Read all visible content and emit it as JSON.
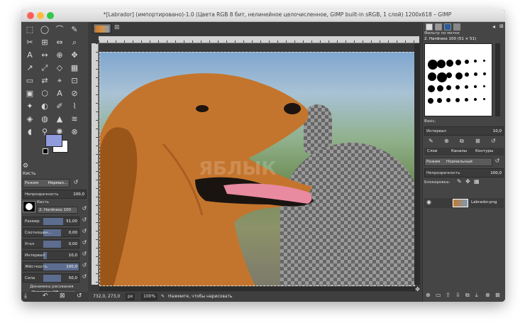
{
  "window": {
    "title": "*[Labrador] (импортировано)-1.0 (Цвета RGB 8 бит, нелинейное целочисленное, GIMP built-in sRGB, 1 слой) 1200x618 – GIMP"
  },
  "colors": {
    "close": "#fc605b",
    "minimize": "#fdbc40",
    "zoom": "#34c84a",
    "fg": "#8f9bdc",
    "bg": "#ffffff",
    "accent": "#5d6d8f"
  },
  "toolbox": {
    "tool_icons": [
      "⬚",
      "◯",
      "⌒",
      "✎",
      "✂",
      "⊞",
      "⇔",
      "⌕",
      "A",
      "↔",
      "⊕",
      "✥",
      "↗",
      "⤢",
      "◇",
      "▦",
      "▭",
      "⇄",
      "⌖",
      "⊡",
      "▣",
      "⬡",
      "A",
      "⊘",
      "✦",
      "◐",
      "✐",
      "⌇",
      "◈",
      "◍",
      "▲",
      "≋",
      "◖",
      "⚲",
      "✺",
      "⊗"
    ],
    "section_title": "Кисть",
    "mode_label": "Режим",
    "mode_value": "Нормал...",
    "opacity_label": "Непрозрачность",
    "opacity_value": "100,0",
    "brush_label": "Кисть",
    "brush_name": "2. Hardness 100",
    "sliders": [
      {
        "label": "Размер",
        "value": "51,00",
        "fill": 0.55
      },
      {
        "label": "Соотношен...",
        "value": "0,00",
        "fill": 0.5
      },
      {
        "label": "Угол",
        "value": "0,00",
        "fill": 0.5
      },
      {
        "label": "Интервал",
        "value": "10,0",
        "fill": 0.1
      },
      {
        "label": "Жёсткость",
        "value": "100,0",
        "fill": 1.0
      },
      {
        "label": "Сила",
        "value": "50,0",
        "fill": 0.5
      }
    ],
    "dynamics_label": "Динамика рисования",
    "dynamics_value": "Dynamics Off"
  },
  "canvas": {
    "status_coords": "732,0, 273,0",
    "status_unit": "px",
    "status_zoom": "100%",
    "status_hint": "Нажмите, чтобы нарисовать",
    "watermark": "ЯБЛЫК"
  },
  "dock": {
    "brush_filter": "Фильтр по метке",
    "brush_title": "2. Hardness 100 (51 × 51)",
    "brush_set": "Basic,",
    "spacing_label": "Интервал",
    "spacing_value": "10,0",
    "tabs": [
      "Слои",
      "Каналы",
      "Контуры"
    ],
    "mode_label": "Режим",
    "mode_value": "Нормальный",
    "opacity_label": "Непрозрачность",
    "opacity_value": "100,0",
    "lock_label": "Блокировка:",
    "layer_name": "Labrador.png"
  }
}
